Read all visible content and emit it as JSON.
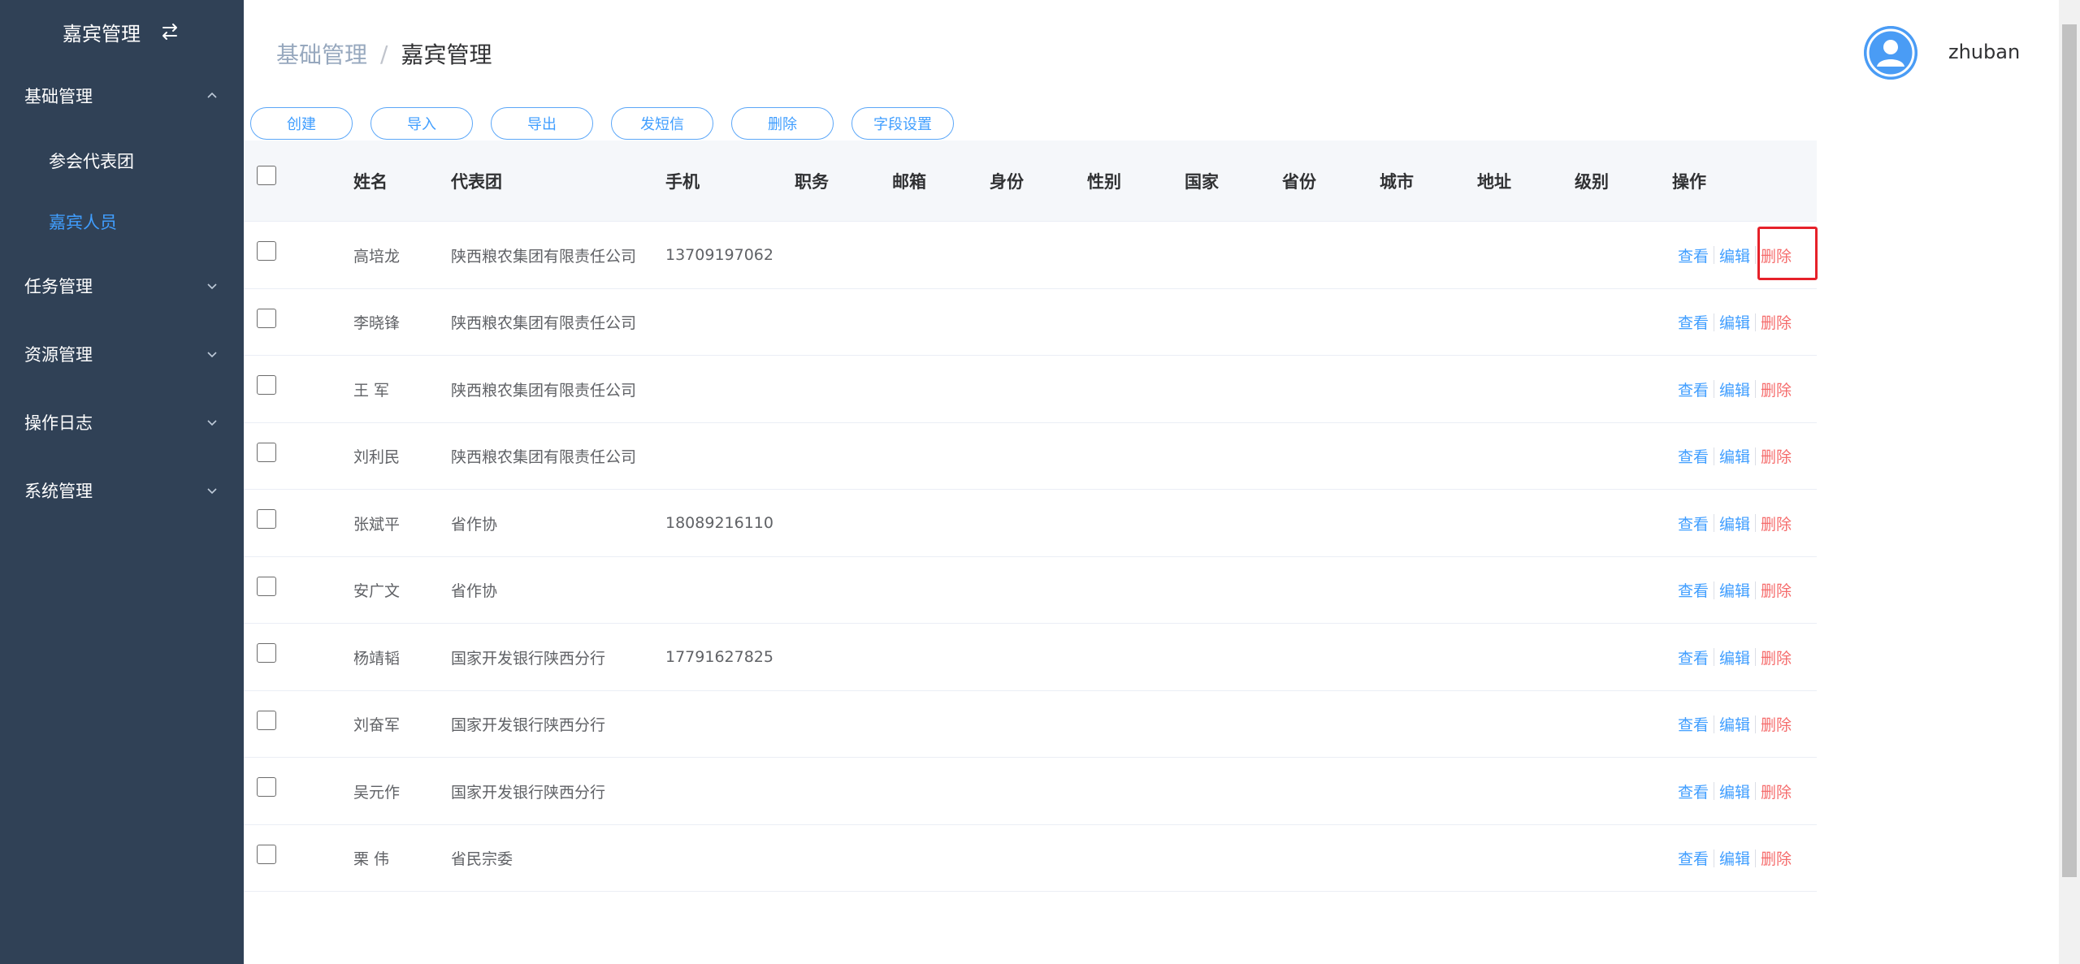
{
  "sidebar": {
    "title": "嘉宾管理",
    "menus": [
      {
        "label": "基础管理",
        "expanded": true,
        "children": [
          "参会代表团",
          "嘉宾人员"
        ],
        "active_child": "嘉宾人员"
      },
      {
        "label": "任务管理",
        "expanded": false
      },
      {
        "label": "资源管理",
        "expanded": false
      },
      {
        "label": "操作日志",
        "expanded": false
      },
      {
        "label": "系统管理",
        "expanded": false
      }
    ]
  },
  "breadcrumb": {
    "parent": "基础管理",
    "separator": "/",
    "current": "嘉宾管理"
  },
  "user": {
    "name": "zhuban"
  },
  "toolbar": {
    "create": "创建",
    "import": "导入",
    "export": "导出",
    "sms": "发短信",
    "delete": "删除",
    "fields": "字段设置"
  },
  "table": {
    "headers": {
      "name": "姓名",
      "group": "代表团",
      "phone": "手机",
      "position": "职务",
      "email": "邮箱",
      "identity": "身份",
      "gender": "性别",
      "country": "国家",
      "province": "省份",
      "city": "城市",
      "address": "地址",
      "level": "级别",
      "ops": "操作"
    },
    "rows": [
      {
        "name": "高培龙",
        "group": "陕西粮农集团有限责任公司",
        "phone": "13709197062"
      },
      {
        "name": "李晓锋",
        "group": "陕西粮农集团有限责任公司",
        "phone": ""
      },
      {
        "name": "王 军",
        "group": "陕西粮农集团有限责任公司",
        "phone": ""
      },
      {
        "name": "刘利民",
        "group": "陕西粮农集团有限责任公司",
        "phone": ""
      },
      {
        "name": "张斌平",
        "group": "省作协",
        "phone": "18089216110"
      },
      {
        "name": "安广文",
        "group": "省作协",
        "phone": ""
      },
      {
        "name": "杨靖韬",
        "group": "国家开发银行陕西分行",
        "phone": "17791627825"
      },
      {
        "name": "刘奋军",
        "group": "国家开发银行陕西分行",
        "phone": ""
      },
      {
        "name": "吴元作",
        "group": "国家开发银行陕西分行",
        "phone": ""
      },
      {
        "name": "栗 伟",
        "group": "省民宗委",
        "phone": ""
      }
    ],
    "actions": {
      "view": "查看",
      "edit": "编辑",
      "delete": "删除"
    }
  },
  "colors": {
    "sidebar_bg": "#304156",
    "accent": "#409eff",
    "danger": "#f56c6c",
    "highlight": "#e6212a"
  }
}
